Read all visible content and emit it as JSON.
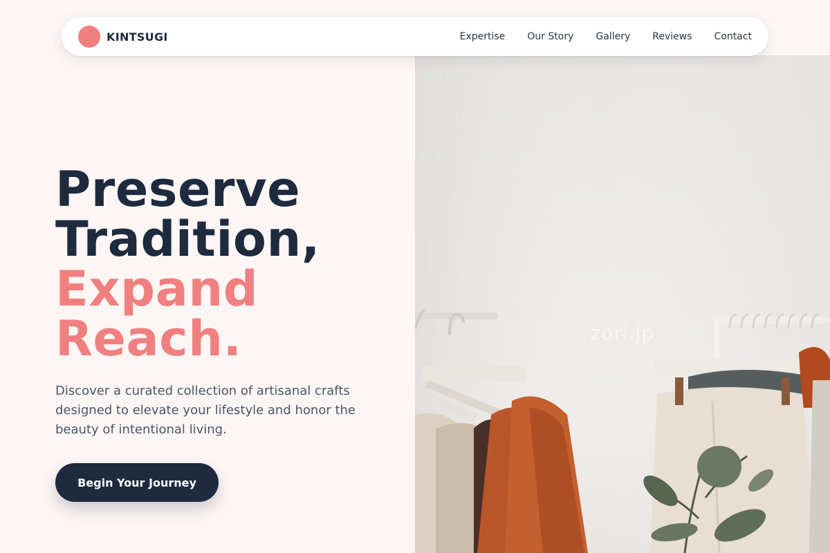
{
  "brand": {
    "name": "KINTSUGI",
    "logo_icon": "circle-logo-icon",
    "accent": "#f08080"
  },
  "nav": {
    "links": [
      {
        "label": "Expertise"
      },
      {
        "label": "Our Story"
      },
      {
        "label": "Gallery"
      },
      {
        "label": "Reviews"
      },
      {
        "label": "Contact"
      }
    ]
  },
  "hero": {
    "headline_dark": [
      "Preserve",
      "Tradition,"
    ],
    "headline_accent": [
      "Expand",
      "Reach."
    ],
    "subtitle": "Discover a curated collection of artisanal crafts designed to elevate your lifestyle and honor the beauty of intentional living.",
    "cta_label": "Begin Your Journey",
    "image_watermark": "zori.jp"
  },
  "colors": {
    "dark": "#1e2a3e",
    "accent": "#f08080",
    "background": "#fdf6f5"
  }
}
